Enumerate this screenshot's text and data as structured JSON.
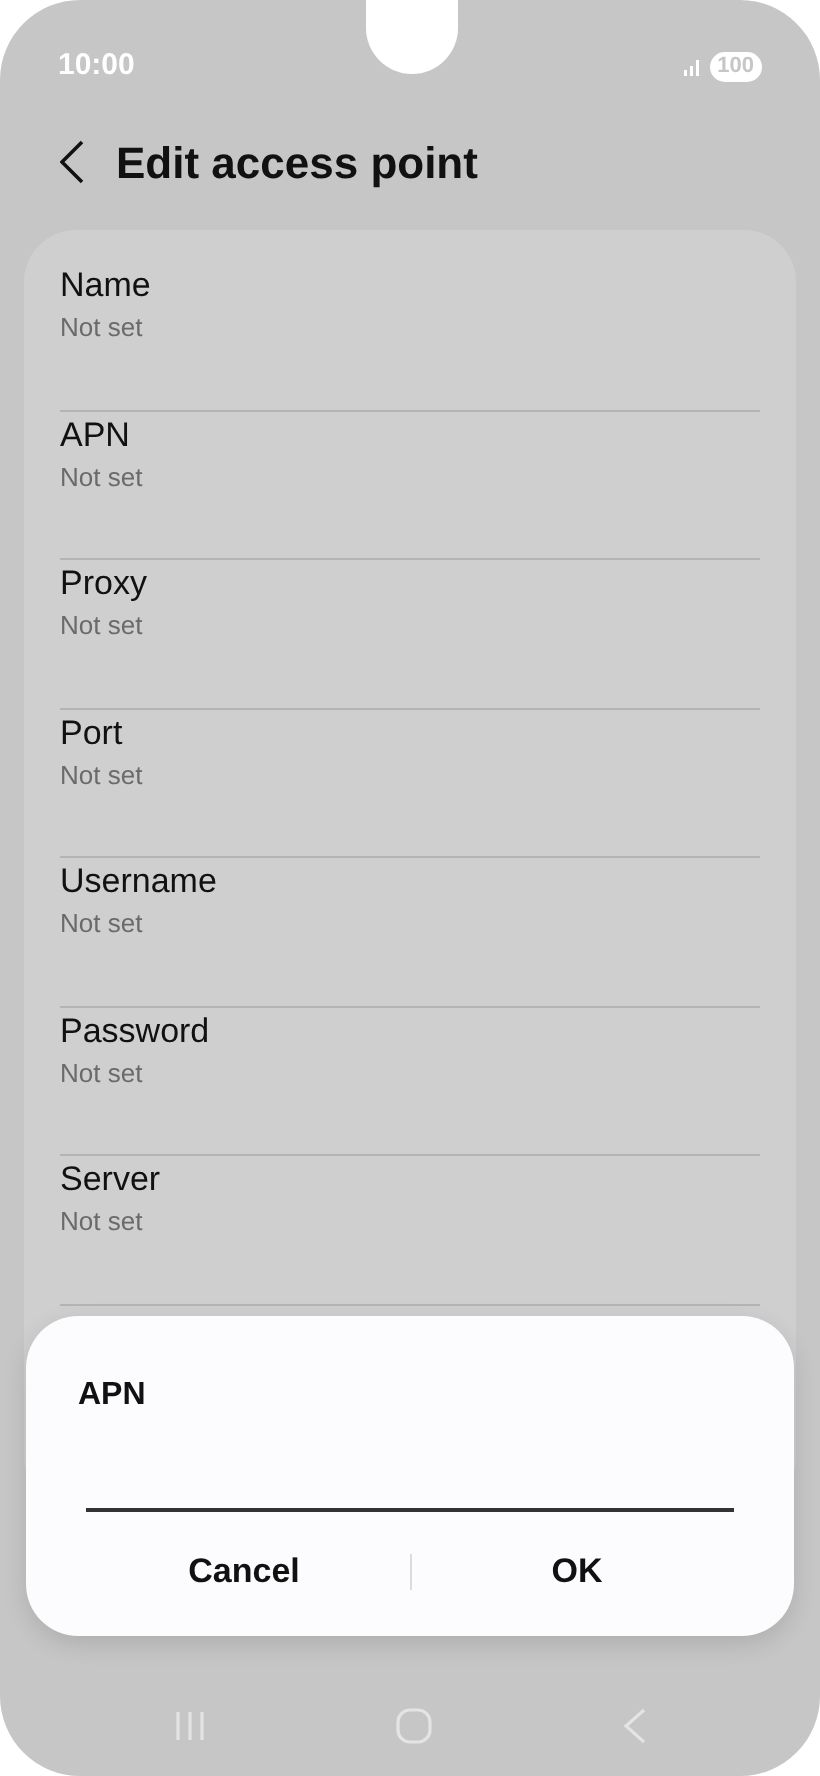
{
  "status_bar": {
    "time": "10:00",
    "battery": "100"
  },
  "header": {
    "title": "Edit access point"
  },
  "fields": [
    {
      "label": "Name",
      "value": "Not set"
    },
    {
      "label": "APN",
      "value": "Not set"
    },
    {
      "label": "Proxy",
      "value": "Not set"
    },
    {
      "label": "Port",
      "value": "Not set"
    },
    {
      "label": "Username",
      "value": "Not set"
    },
    {
      "label": "Password",
      "value": "Not set"
    },
    {
      "label": "Server",
      "value": "Not set"
    }
  ],
  "dialog": {
    "title": "APN",
    "buttons": [
      "Cancel",
      "OK"
    ]
  }
}
